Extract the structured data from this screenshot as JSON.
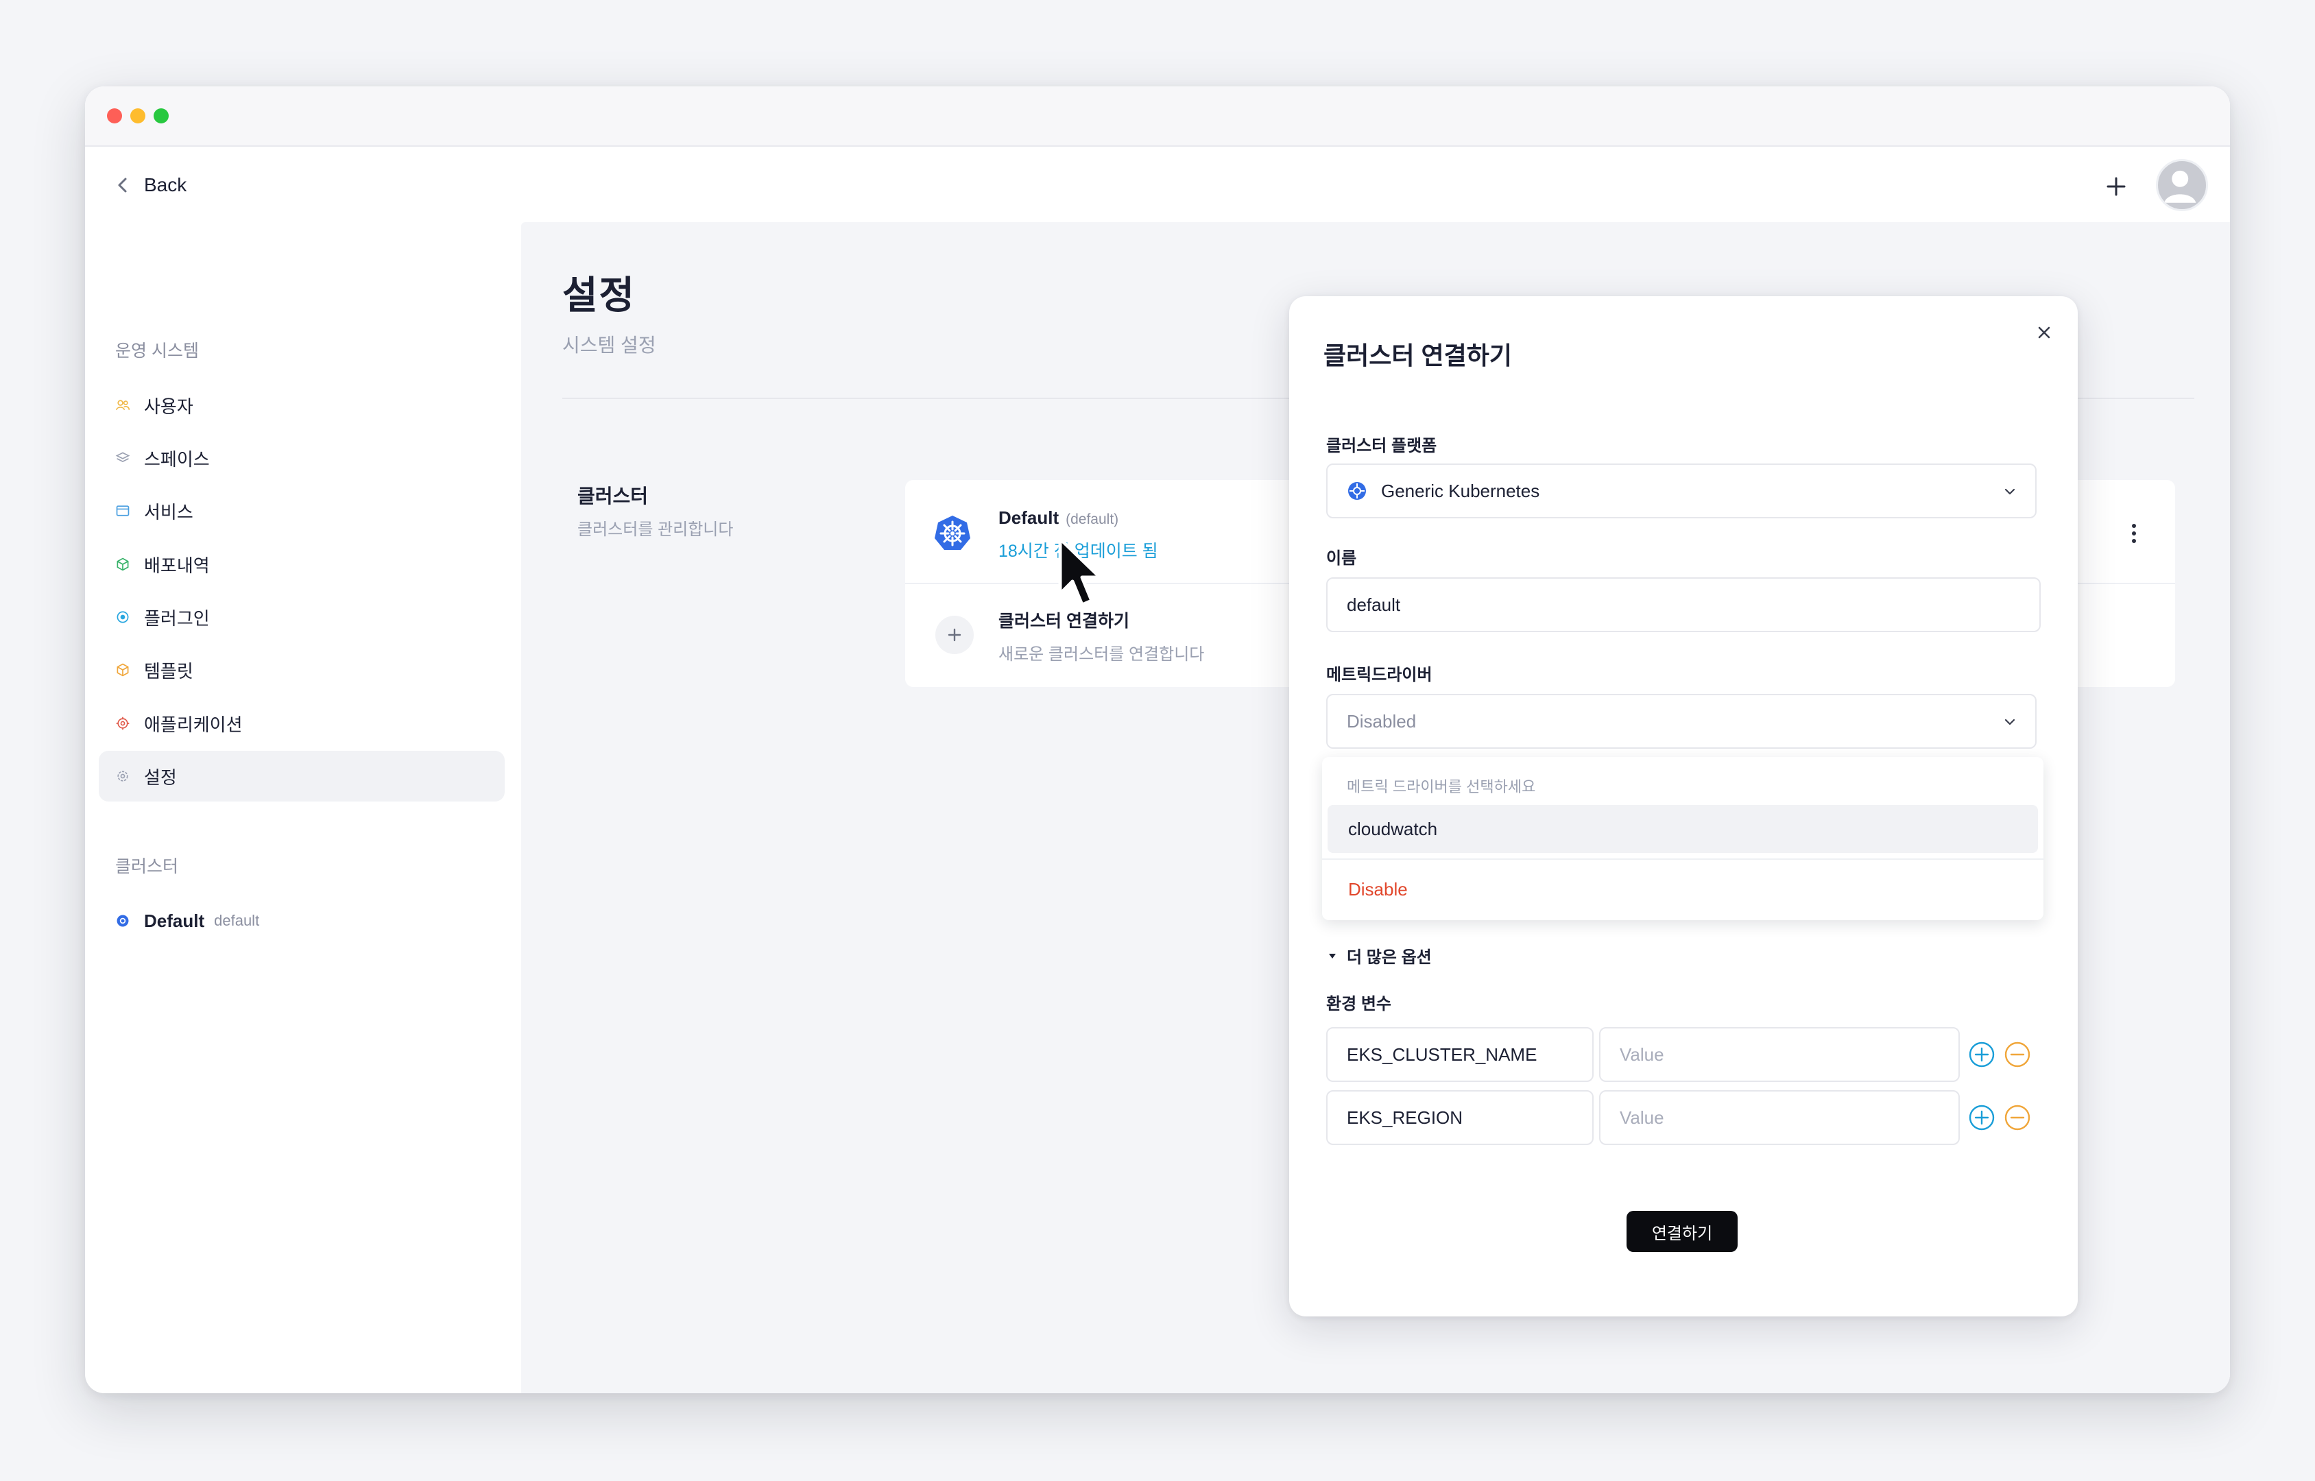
{
  "topbar": {
    "back_label": "Back"
  },
  "sidebar": {
    "section_system": "운영 시스템",
    "items": [
      {
        "label": "사용자",
        "icon": "users-icon",
        "color": "#f0b94a"
      },
      {
        "label": "스페이스",
        "icon": "layers-icon",
        "color": "#9aa0b1"
      },
      {
        "label": "서비스",
        "icon": "window-icon",
        "color": "#4a9fe0"
      },
      {
        "label": "배포내역",
        "icon": "cube-icon",
        "color": "#38b26a"
      },
      {
        "label": "플러그인",
        "icon": "plugin-icon",
        "color": "#29a7e0"
      },
      {
        "label": "템플릿",
        "icon": "box-icon",
        "color": "#f0a63a"
      },
      {
        "label": "애플리케이션",
        "icon": "app-icon",
        "color": "#e05a4a"
      },
      {
        "label": "설정",
        "icon": "gear-icon",
        "color": "#9aa0b1"
      }
    ],
    "section_cluster": "클러스터",
    "cluster_item": {
      "label": "Default",
      "sub": "default"
    }
  },
  "main": {
    "title": "설정",
    "subtitle": "시스템 설정",
    "section_title": "클러스터",
    "section_sub": "클러스터를 관리합니다",
    "cluster": {
      "name": "Default",
      "tag": "(default)",
      "updated": "18시간 전 업데이트 됨"
    },
    "add": {
      "title": "클러스터 연결하기",
      "sub": "새로운 클러스터를 연결합니다"
    }
  },
  "modal": {
    "title": "클러스터 연결하기",
    "platform_label": "클러스터 플랫폼",
    "platform_value": "Generic Kubernetes",
    "name_label": "이름",
    "name_value": "default",
    "metric_label": "메트릭드라이버",
    "metric_value": "Disabled",
    "dropdown": {
      "header": "메트릭 드라이버를 선택하세요",
      "options": [
        "cloudwatch",
        "Disable"
      ]
    },
    "more_options": "더 많은 옵션",
    "env_label": "환경 변수",
    "env": [
      {
        "key": "EKS_CLUSTER_NAME",
        "placeholder": "Value"
      },
      {
        "key": "EKS_REGION",
        "placeholder": "Value"
      }
    ],
    "connect_label": "연결하기"
  },
  "colors": {
    "accent": "#1a9ed8",
    "danger": "#e1472c",
    "k8s": "#326ce5",
    "minus": "#f0a63a"
  }
}
